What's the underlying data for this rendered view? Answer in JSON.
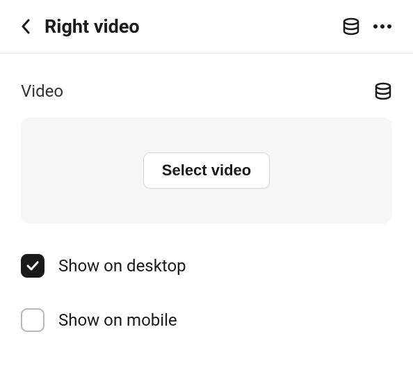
{
  "header": {
    "title": "Right video"
  },
  "section": {
    "label": "Video",
    "selectButton": "Select video"
  },
  "options": {
    "desktop": {
      "label": "Show on desktop",
      "checked": true
    },
    "mobile": {
      "label": "Show on mobile",
      "checked": false
    }
  }
}
